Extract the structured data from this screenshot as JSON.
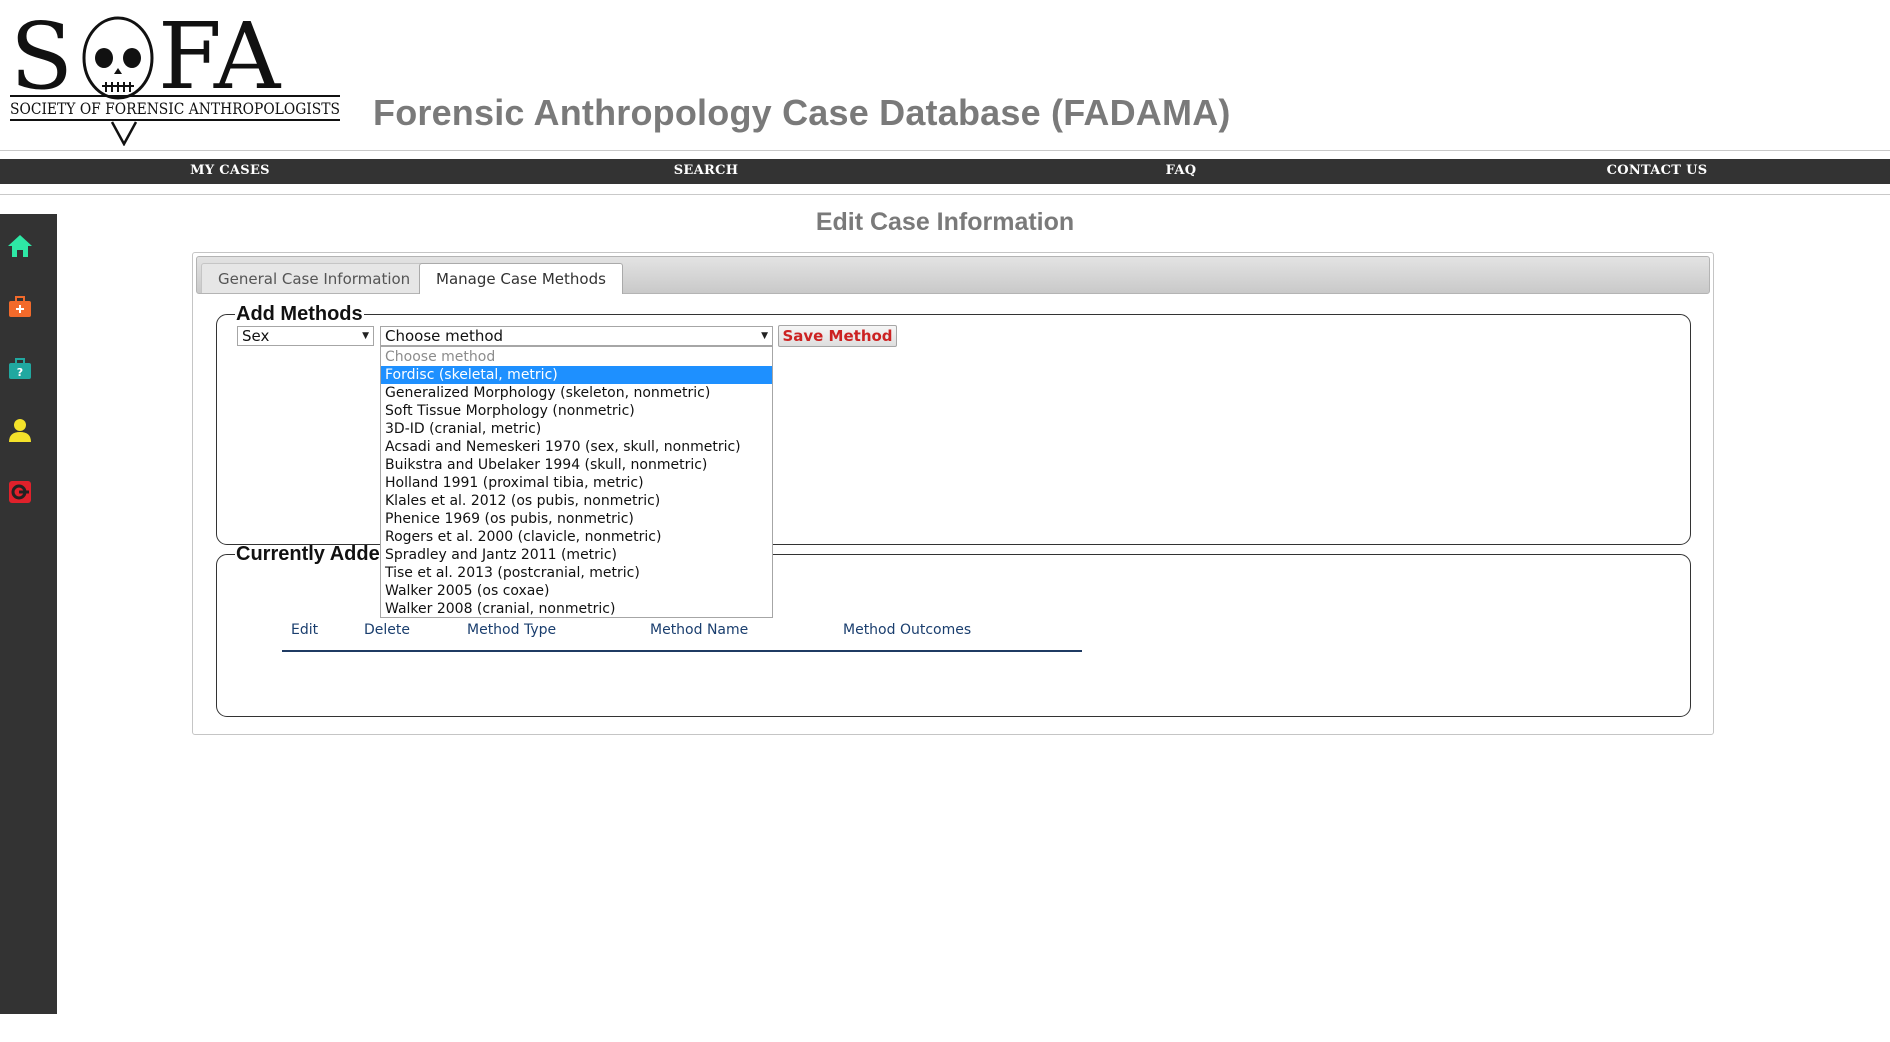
{
  "logo": {
    "letters": "S  FA",
    "subtitle": "SOCIETY OF FORENSIC ANTHROPOLOGISTS"
  },
  "app_title": "Forensic Anthropology Case Database (FADAMA)",
  "nav": [
    {
      "label": "MY CASES"
    },
    {
      "label": "SEARCH"
    },
    {
      "label": "FAQ"
    },
    {
      "label": "CONTACT US"
    }
  ],
  "sidebar": [
    {
      "icon": "home-icon",
      "color": "#2ee8a5"
    },
    {
      "icon": "add-case-icon",
      "color": "#f26a2b"
    },
    {
      "icon": "help-case-icon",
      "color": "#21a8a0"
    },
    {
      "icon": "user-icon",
      "color": "#f4e22a"
    },
    {
      "icon": "logout-icon",
      "color": "#e0212b"
    }
  ],
  "page_title": "Edit Case Information",
  "tabs": [
    {
      "label": "General Case Information",
      "active": false
    },
    {
      "label": "Manage Case Methods",
      "active": true
    }
  ],
  "add_methods": {
    "legend": "Add Methods",
    "type_select": "Sex",
    "method_select": "Choose method",
    "save_label": "Save Method"
  },
  "dropdown_options": [
    "Choose method",
    "Fordisc (skeletal, metric)",
    "Generalized Morphology (skeleton, nonmetric)",
    "Soft Tissue Morphology (nonmetric)",
    "3D-ID (cranial, metric)",
    "Acsadi and Nemeskeri 1970 (sex, skull, nonmetric)",
    "Buikstra and Ubelaker 1994 (skull, nonmetric)",
    "Holland 1991 (proximal tibia, metric)",
    "Klales et al. 2012 (os pubis, nonmetric)",
    "Phenice 1969 (os pubis, nonmetric)",
    "Rogers et al. 2000 (clavicle, nonmetric)",
    "Spradley and Jantz 2011 (metric)",
    "Tise et al. 2013 (postcranial, metric)",
    "Walker 2005 (os coxae)",
    "Walker 2008 (cranial, nonmetric)"
  ],
  "dropdown_highlighted": "Fordisc (skeletal, metric)",
  "current_methods": {
    "legend": "Currently Adde",
    "columns": [
      "Edit",
      "Delete",
      "Method Type",
      "Method Name",
      "Method Outcomes"
    ]
  }
}
